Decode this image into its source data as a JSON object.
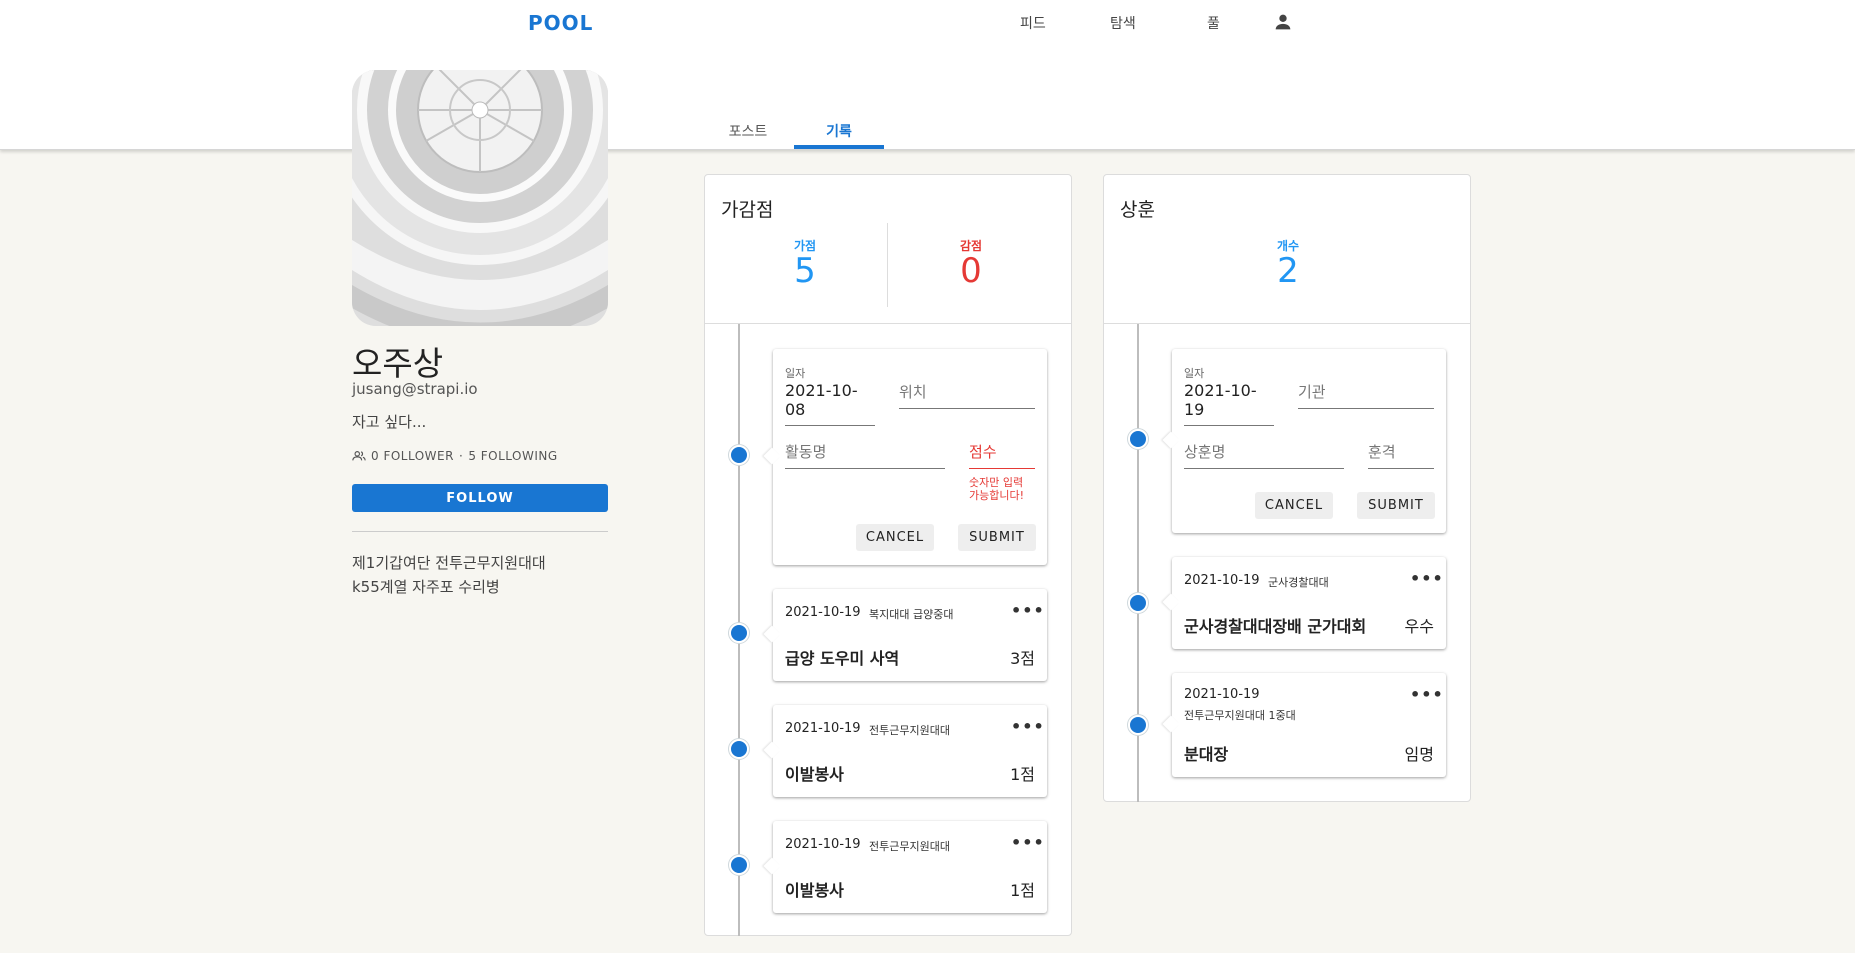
{
  "nav": {
    "logo": "POOL",
    "feed": "피드",
    "explore": "탐색",
    "pool": "풀",
    "user_icon": "person-icon"
  },
  "tabs": {
    "posts": "포스트",
    "records": "기록"
  },
  "profile": {
    "name": "오주상",
    "email": "jusang@strapi.io",
    "status": "자고 싶다...",
    "followers": "0 FOLLOWER",
    "separator": "·",
    "following": "5 FOLLOWING",
    "follow_button": "FOLLOW",
    "bio_line1": "제1기갑여단 전투근무지원대대",
    "bio_line2": "k55계열 자주포 수리병"
  },
  "points_panel": {
    "title": "가감점",
    "plus_label": "가점",
    "plus_value": "5",
    "minus_label": "감점",
    "minus_value": "0",
    "form": {
      "date_label": "일자",
      "date_value": "2021-10-08",
      "location_placeholder": "위치",
      "activity_placeholder": "활동명",
      "score_placeholder": "점수",
      "score_error_line1": "숫자만 입력",
      "score_error_line2": "가능합니다!",
      "cancel": "CANCEL",
      "submit": "SUBMIT"
    },
    "records": [
      {
        "date": "2021-10-19",
        "org": "복지대대 급양중대",
        "title": "급양 도우미 사역",
        "score": "3점"
      },
      {
        "date": "2021-10-19",
        "org": "전투근무지원대대",
        "title": "이발봉사",
        "score": "1점"
      },
      {
        "date": "2021-10-19",
        "org": "전투근무지원대대",
        "title": "이발봉사",
        "score": "1점"
      }
    ]
  },
  "awards_panel": {
    "title": "상훈",
    "count_label": "개수",
    "count_value": "2",
    "form": {
      "date_label": "일자",
      "date_value": "2021-10-19",
      "agency_placeholder": "기관",
      "award_placeholder": "상훈명",
      "grade_placeholder": "훈격",
      "cancel": "CANCEL",
      "submit": "SUBMIT"
    },
    "records": [
      {
        "date": "2021-10-19",
        "org": "군사경찰대대",
        "title": "군사경찰대대장배 군가대회",
        "grade": "우수"
      },
      {
        "date": "2021-10-19",
        "org": "전투근무지원대대 1중대",
        "title": "분대장",
        "grade": "임명"
      }
    ]
  },
  "colors": {
    "accent": "#1976d2",
    "stat_blue": "#2196f3",
    "stat_red": "#e53935",
    "background": "#f7f6f1"
  }
}
